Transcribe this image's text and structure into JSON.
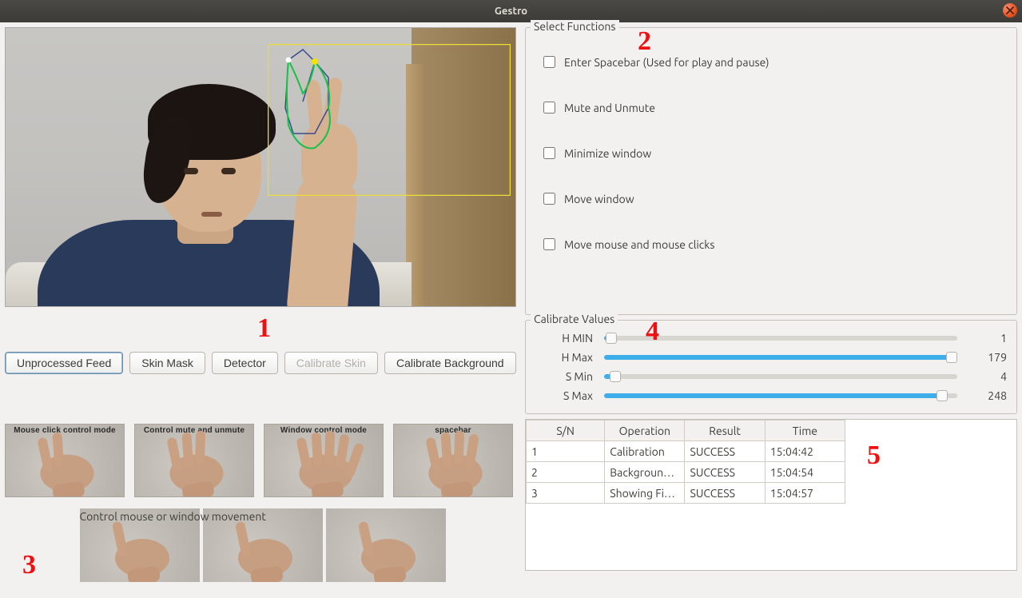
{
  "window": {
    "title": "Gestro"
  },
  "buttons": {
    "unprocessed": "Unprocessed Feed",
    "skinmask": "Skin Mask",
    "detector": "Detector",
    "calibskin": "Calibrate Skin",
    "calibbg": "Calibrate Background"
  },
  "callouts": {
    "c1": "1",
    "c2": "2",
    "c3": "3",
    "c4": "4",
    "c5": "5"
  },
  "functions": {
    "legend": "Select Functions",
    "items": [
      "Enter Spacebar (Used for play and pause)",
      "Mute and Unmute",
      "Minimize window",
      "Move window",
      "Move mouse and mouse clicks"
    ]
  },
  "calibrate": {
    "legend": "Calibrate Values",
    "rows": [
      {
        "label": "H MIN",
        "value": 1,
        "min": 0,
        "max": 179
      },
      {
        "label": "H Max",
        "value": 179,
        "min": 0,
        "max": 179
      },
      {
        "label": "S Min",
        "value": 4,
        "min": 0,
        "max": 255
      },
      {
        "label": "S Max",
        "value": 248,
        "min": 0,
        "max": 255
      }
    ]
  },
  "thumbs": {
    "row1": [
      "Mouse click control mode",
      "Control mute and unmute",
      "Window control mode",
      "spacebar"
    ],
    "row2_label": "Control mouse or window movement"
  },
  "log": {
    "headers": [
      "S/N",
      "Operation",
      "Result",
      "Time"
    ],
    "rows": [
      {
        "sn": "1",
        "op": "Calibration",
        "result": "SUCCESS",
        "time": "15:04:42"
      },
      {
        "sn": "2",
        "op": "Backgroun…",
        "result": "SUCCESS",
        "time": "15:04:54"
      },
      {
        "sn": "3",
        "op": "Showing Fi…",
        "result": "SUCCESS",
        "time": "15:04:57"
      }
    ]
  }
}
